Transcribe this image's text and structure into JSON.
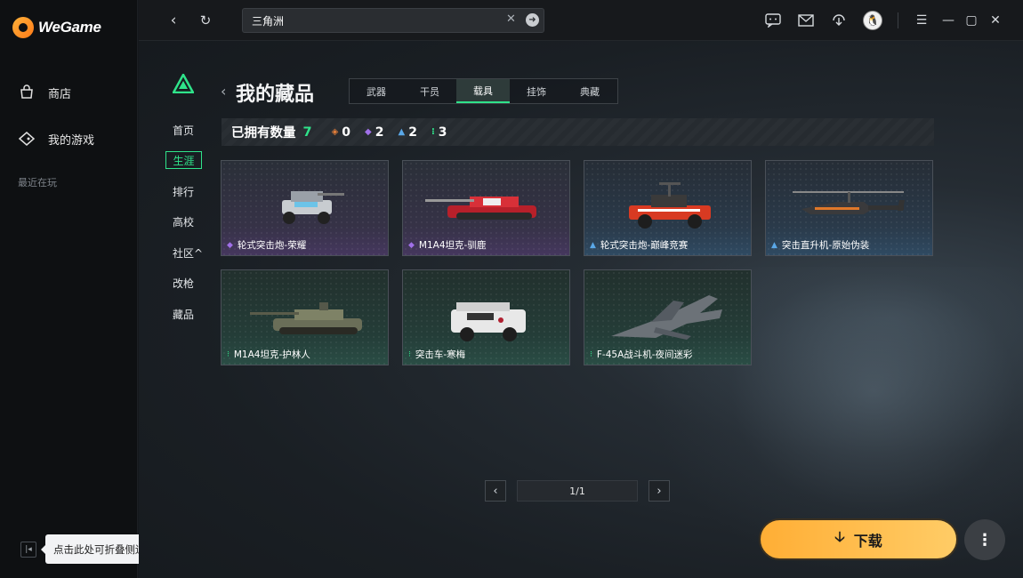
{
  "app": {
    "logo_text": "WeGame"
  },
  "sidebar": {
    "items": [
      {
        "label": "商店",
        "icon": "shop-icon"
      },
      {
        "label": "我的游戏",
        "icon": "gamepad-icon"
      }
    ],
    "recent_label": "最近在玩",
    "collapse_tooltip": "点击此处可折叠侧边栏"
  },
  "search": {
    "value": "三角洲"
  },
  "game_nav": {
    "items": [
      "首页",
      "生涯",
      "排行",
      "高校",
      "社区^",
      "改枪",
      "藏品"
    ],
    "active": "生涯"
  },
  "header": {
    "title": "我的藏品",
    "tabs": [
      "武器",
      "干员",
      "载具",
      "挂饰",
      "典藏"
    ],
    "active_tab": "载具"
  },
  "owned": {
    "label": "已拥有数量",
    "total": "7",
    "rarity_counts": [
      {
        "glyph": "◈",
        "count": "0",
        "color": "#e8803a"
      },
      {
        "glyph": "◆",
        "count": "2",
        "color": "#a070e8"
      },
      {
        "glyph": "▲",
        "count": "2",
        "color": "#5aa8e8"
      },
      {
        "glyph": "⁝",
        "count": "3",
        "color": "#2fe38a"
      }
    ]
  },
  "cards": [
    {
      "name": "轮式突击炮-荣耀",
      "rarity": "purple"
    },
    {
      "name": "M1A4坦克-驯鹿",
      "rarity": "purple"
    },
    {
      "name": "轮式突击炮-巅峰竞赛",
      "rarity": "blue"
    },
    {
      "name": "突击直升机-原始伪装",
      "rarity": "blue"
    },
    {
      "name": "M1A4坦克-护林人",
      "rarity": "green"
    },
    {
      "name": "突击车-寒梅",
      "rarity": "green"
    },
    {
      "name": "F-45A战斗机-夜间迷彩",
      "rarity": "green"
    }
  ],
  "pagination": {
    "text": "1/1"
  },
  "download": {
    "label": "下载"
  },
  "colors": {
    "accent": "#2fe38a",
    "download": "#ffb940"
  }
}
